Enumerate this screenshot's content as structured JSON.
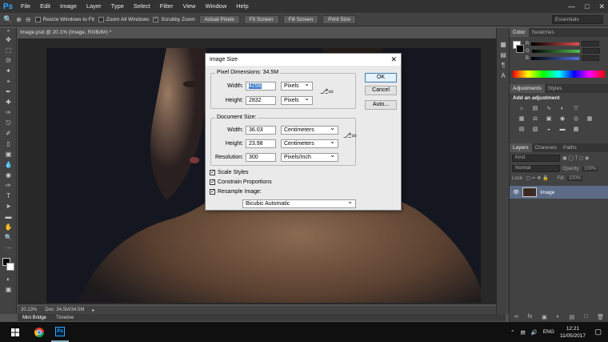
{
  "app": {
    "logo": "Ps"
  },
  "menu": [
    "File",
    "Edit",
    "Image",
    "Layer",
    "Type",
    "Select",
    "Filter",
    "View",
    "Window",
    "Help"
  ],
  "options_bar": {
    "resize_windows": "Resize Windows to Fit",
    "zoom_all": "Zoom All Windows",
    "scrubby_zoom": "Scrubby Zoom",
    "actual_pixels": "Actual Pixels",
    "fit_screen": "Fit Screen",
    "fill_screen": "Fill Screen",
    "print_size": "Print Size",
    "workspace": "Essentials"
  },
  "document": {
    "tab": "Image.psd @ 20.1% (Image, RGB/8#) *",
    "zoom": "20.13%",
    "doc_size": "Doc: 34.5M/34.5M"
  },
  "bottom_tabs": [
    "Mini Bridge",
    "Timeline"
  ],
  "panels": {
    "color_tabs": [
      "Color",
      "Swatches"
    ],
    "channels": [
      {
        "label": "R",
        "color": "#e05050"
      },
      {
        "label": "G",
        "color": "#50c050"
      },
      {
        "label": "B",
        "color": "#5070e0"
      }
    ],
    "adjust_tabs": [
      "Adjustments",
      "Styles"
    ],
    "adjust_title": "Add an adjustment",
    "layers_tabs": [
      "Layers",
      "Channels",
      "Paths"
    ],
    "kind": "Kind",
    "blend": "Normal",
    "opacity_label": "Opacity:",
    "opacity_value": "100%",
    "lock_label": "Lock:",
    "fill_label": "Fill:",
    "fill_value": "100%",
    "layer_name": "Image"
  },
  "dialog": {
    "title": "Image Size",
    "close": "✕",
    "pixel_dimensions": "Pixel Dimensions:  34.5M",
    "width_label": "Width:",
    "width_value": "4256",
    "width_unit": "Pixels",
    "height_label": "Height:",
    "height_value": "2832",
    "height_unit": "Pixels",
    "document_size": "Document Size:",
    "doc_width_label": "Width:",
    "doc_width_value": "36.03",
    "doc_width_unit": "Centimeters",
    "doc_height_label": "Height:",
    "doc_height_value": "23.98",
    "doc_height_unit": "Centimeters",
    "resolution_label": "Resolution:",
    "resolution_value": "300",
    "resolution_unit": "Pixels/Inch",
    "scale_styles": "Scale Styles",
    "constrain": "Constrain Proportions",
    "resample": "Resample Image:",
    "resample_method": "Bicubic Automatic",
    "ok": "OK",
    "cancel": "Cancel",
    "auto": "Auto..."
  },
  "taskbar": {
    "language": "ENG",
    "time": "12:21",
    "date": "11/05/2017"
  }
}
